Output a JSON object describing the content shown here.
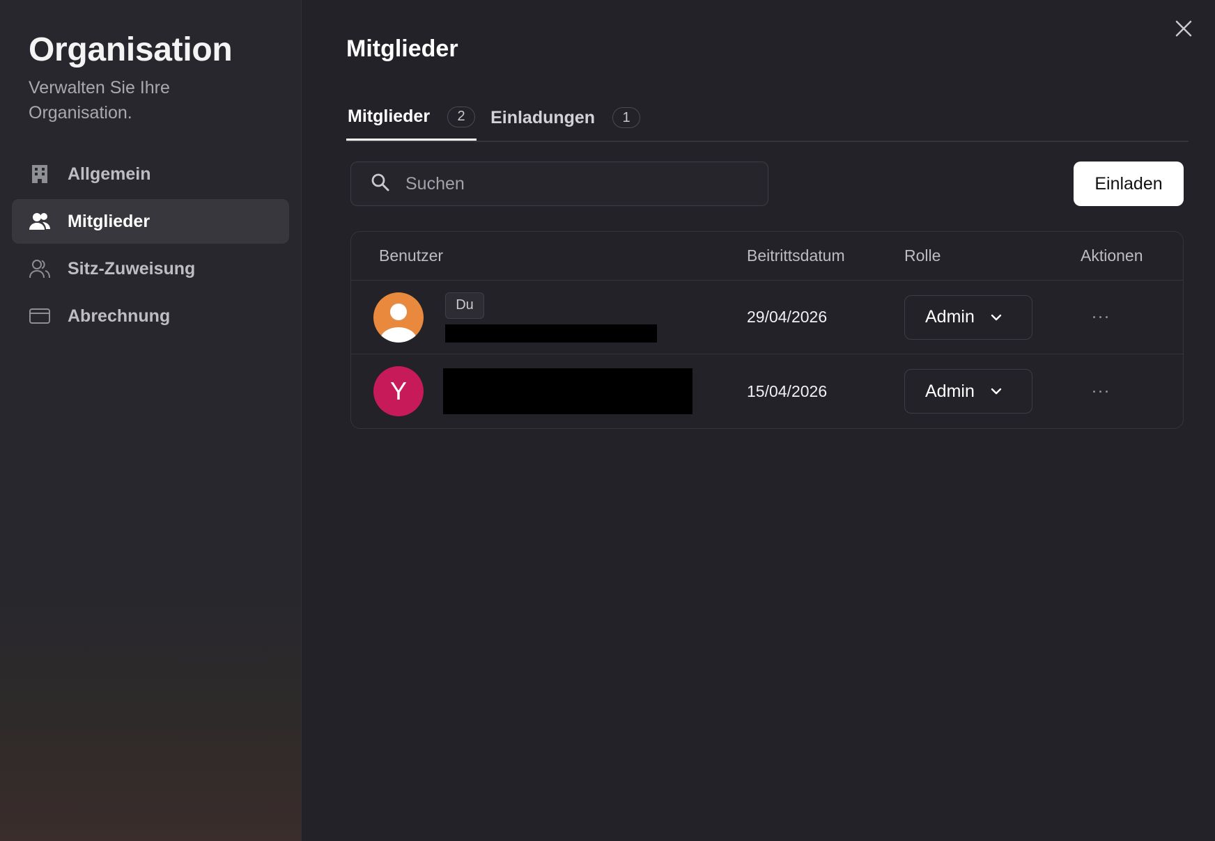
{
  "sidebar": {
    "title": "Organisation",
    "subtitle": "Verwalten Sie Ihre Organisation.",
    "items": [
      {
        "label": "Allgemein",
        "icon": "building-icon",
        "active": false
      },
      {
        "label": "Mitglieder",
        "icon": "users-filled-icon",
        "active": true
      },
      {
        "label": "Sitz-Zuweisung",
        "icon": "users-outline-icon",
        "active": false
      },
      {
        "label": "Abrechnung",
        "icon": "credit-card-icon",
        "active": false
      }
    ]
  },
  "main": {
    "title": "Mitglieder",
    "close_icon": "close-icon",
    "tabs": [
      {
        "label": "Mitglieder",
        "count": "2",
        "active": true
      },
      {
        "label": "Einladungen",
        "count": "1",
        "active": false
      }
    ],
    "search": {
      "placeholder": "Suchen",
      "value": "",
      "icon": "search-icon"
    },
    "invite_label": "Einladen",
    "table": {
      "headers": {
        "user": "Benutzer",
        "date": "Beitrittsdatum",
        "role": "Rolle",
        "actions": "Aktionen"
      },
      "rows": [
        {
          "avatar": "person-avatar",
          "badge": "Du",
          "name": "[redacted]",
          "date": "29/04/2026",
          "role": "Admin"
        },
        {
          "avatar_letter": "Y",
          "name": "[redacted]",
          "date": "15/04/2026",
          "role": "Admin"
        }
      ]
    }
  },
  "colors": {
    "background": "#222228",
    "sidebar": "#27272d",
    "active_nav": "#37373d",
    "avatar_orange": "#e8893e",
    "avatar_magenta": "#c61a59",
    "primary_button": "#ffffff"
  }
}
